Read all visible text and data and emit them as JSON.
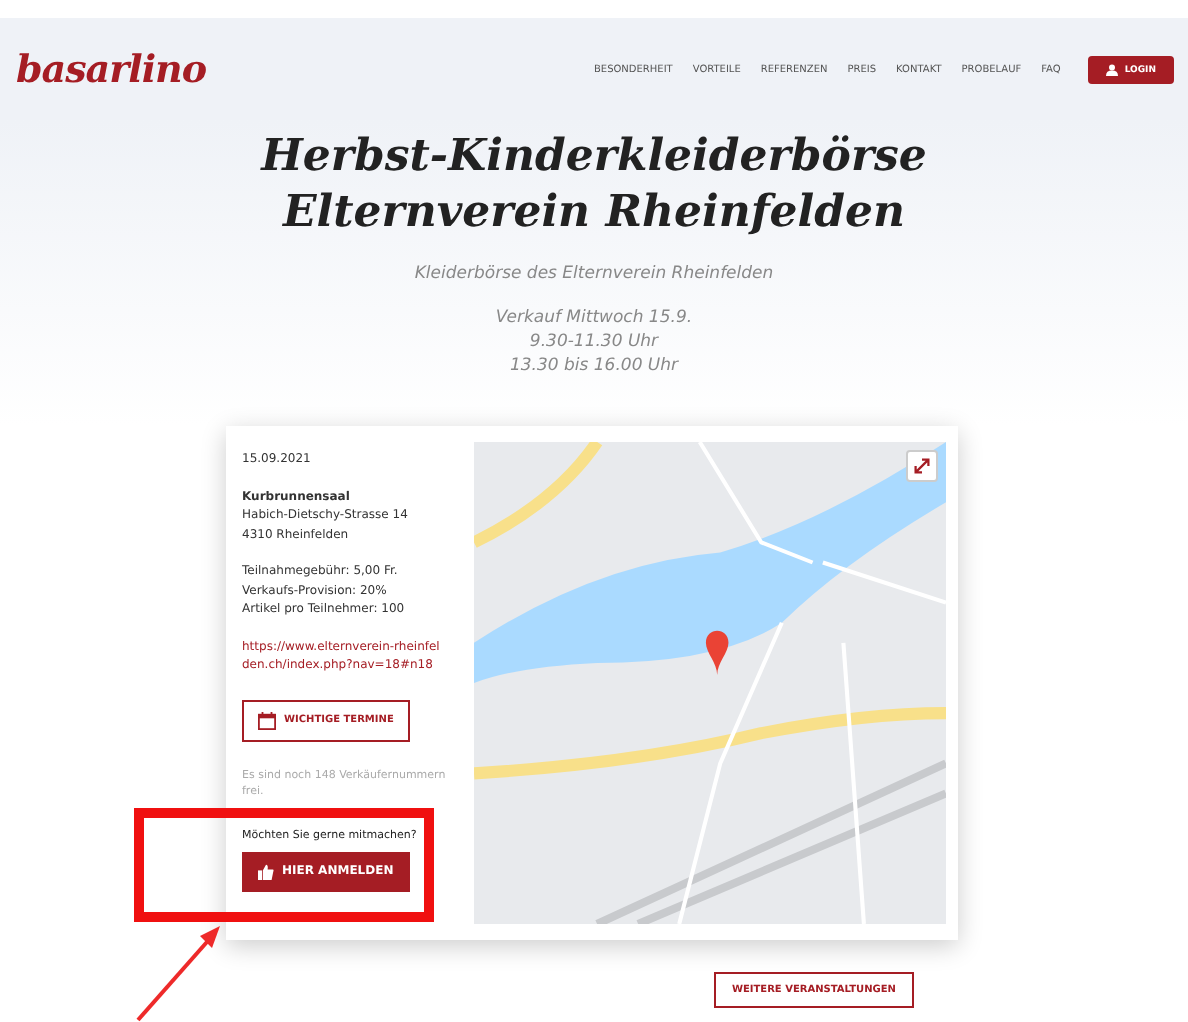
{
  "header": {
    "logo": "basarlino",
    "nav": [
      "BESONDERHEIT",
      "VORTEILE",
      "REFERENZEN",
      "PREIS",
      "KONTAKT",
      "PROBELAUF",
      "FAQ"
    ],
    "login": "LOGIN"
  },
  "hero": {
    "title_lines": [
      "Herbst-Kinderkleiderbörse",
      "Elternverein Rheinfelden"
    ],
    "subtitle": "Kleiderbörse des Elternverein Rheinfelden",
    "sale_lines": [
      "Verkauf Mittwoch 15.9.",
      "9.30-11.30 Uhr",
      "13.30 bis 16.00 Uhr"
    ]
  },
  "event": {
    "date": "15.09.2021",
    "address_lines": [
      "Kurbrunnensaal",
      "Habich-Dietschy-Strasse 14",
      "4310 Rheinfelden"
    ],
    "info_lines": [
      "Teilnahmegebühr: 5,00 Fr.",
      "Verkaufs-Provision: 20%",
      "Artikel pro Teilnehmer: 100"
    ],
    "link": "https://www.elternverein-rheinfelden.ch/index.php?nav=18#n18",
    "dates_button": "WICHTIGE TERMINE",
    "availability": "Es sind noch 148 Verkäufernummern frei.",
    "question": "Möchten Sie gerne mitmachen?",
    "register_button": "HIER ANMELDEN"
  },
  "more_button": "WEITERE VERANSTALTUNGEN"
}
